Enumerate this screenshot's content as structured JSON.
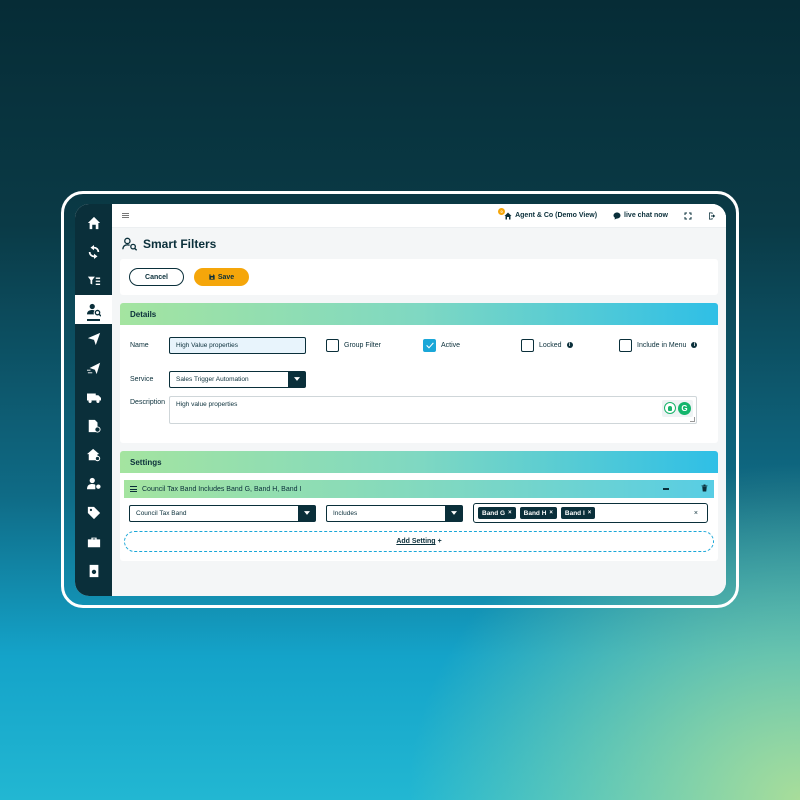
{
  "topbar": {
    "notification_count": "0",
    "agency_label": "Agent & Co (Demo View)",
    "chat_label": "live chat now"
  },
  "page": {
    "title": "Smart Filters"
  },
  "actions": {
    "cancel_label": "Cancel",
    "save_label": "Save"
  },
  "details": {
    "header": "Details",
    "name_label": "Name",
    "name_value": "High Value properties",
    "group_filter_label": "Group Filter",
    "active_label": "Active",
    "locked_label": "Locked",
    "include_in_menu_label": "Include in Menu",
    "service_label": "Service",
    "service_value": "Sales Trigger Automation",
    "description_label": "Description",
    "description_value": "High value properties",
    "checkboxes": {
      "group_filter": false,
      "active": true,
      "locked": false,
      "include_in_menu": false
    }
  },
  "settings": {
    "header": "Settings",
    "rule_title": "Council Tax Band Includes Band G, Band H, Band I",
    "field_value": "Council Tax Band",
    "operator_value": "Includes",
    "tags": [
      "Band G",
      "Band H",
      "Band I"
    ],
    "tag_remove_glyph": "×",
    "clear_glyph": "×",
    "add_setting_label": "Add Setting",
    "add_plus": "+"
  },
  "colors": {
    "navy": "#0a2f3a",
    "accent_blue": "#1aa7d8",
    "save_orange": "#f5a60a",
    "green": "#a4e4a0"
  }
}
